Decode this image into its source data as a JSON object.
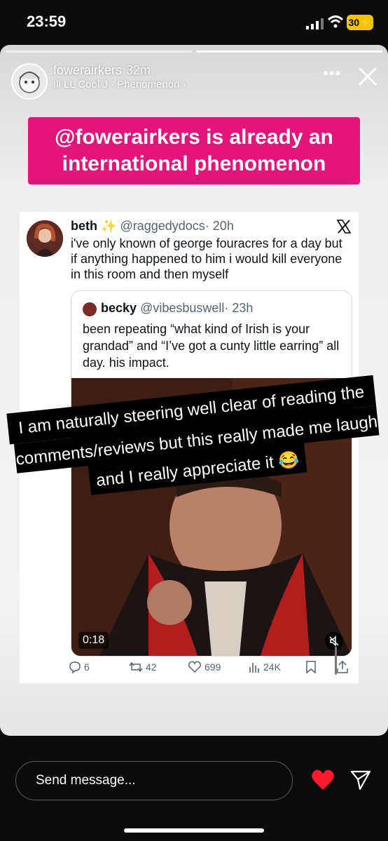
{
  "status": {
    "time": "23:59",
    "battery": "30"
  },
  "story": {
    "username": "fowerairkers",
    "age": "32m",
    "music": "LL Cool J · Phenomenon",
    "banner_line1": "@fowerairkers is already an",
    "banner_line2": "international phenomenon",
    "caption_line1": "I am naturally steering well clear of reading the",
    "caption_line2": "comments/reviews but this really made me laugh",
    "caption_line3": "and I really appreciate it 😂"
  },
  "tweet": {
    "name": "beth",
    "name_emoji": "✨",
    "handle": "@raggedydocs",
    "time": "· 20h",
    "body": "i've only known of george fouracres for a day but if anything happened to him i would kill everyone in this room and then myself",
    "quote": {
      "name": "becky",
      "handle": "@vibesbuswell",
      "time": "· 23h",
      "body": "been repeating “what kind of Irish is your grandad” and “I’ve got a cunty little earring” all day. his impact.",
      "video_time": "0:18"
    },
    "actions": {
      "replies": "6",
      "reposts": "42",
      "likes": "699",
      "views": "24K"
    }
  },
  "footer": {
    "message_placeholder": "Send message..."
  }
}
